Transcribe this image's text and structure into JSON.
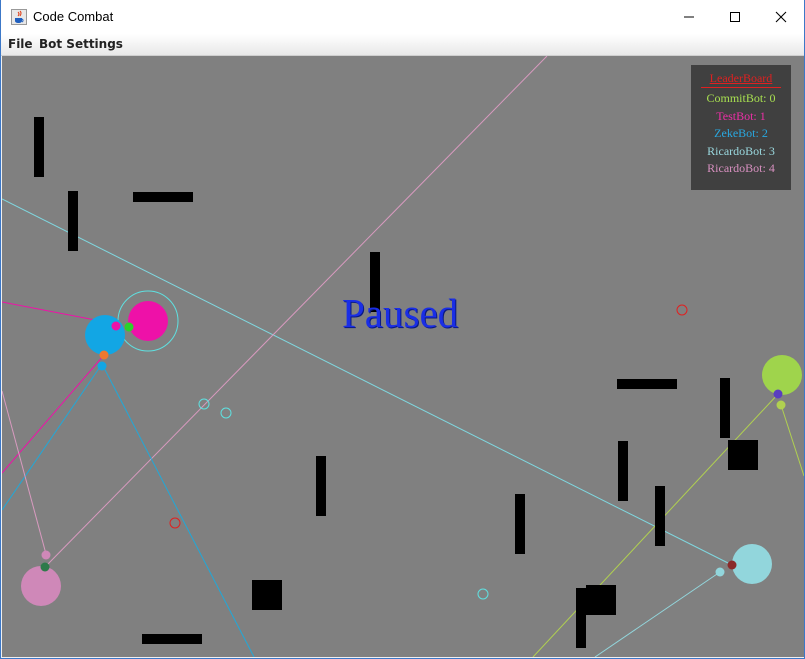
{
  "window": {
    "title": "Code Combat",
    "icon": "java-cup-icon",
    "controls": [
      "minimize-icon",
      "maximize-icon",
      "close-icon"
    ]
  },
  "menu": {
    "items": [
      "File",
      "Bot Settings"
    ]
  },
  "arena": {
    "status_text": "Paused",
    "background_color": "#808080"
  },
  "leaderboard": {
    "title": "LeaderBoard",
    "title_color": "#e02020",
    "rows": [
      {
        "text": "CommitBot: 0",
        "color": "#a8e050"
      },
      {
        "text": "TestBot: 1",
        "color": "#ee2fa8"
      },
      {
        "text": "ZekeBot: 2",
        "color": "#29a8e0"
      },
      {
        "text": "RicardoBot: 3",
        "color": "#9ad8de"
      },
      {
        "text": "RicardoBot: 4",
        "color": "#d890c0"
      }
    ]
  },
  "bots": [
    {
      "name": "CommitBot",
      "color": "#9fd44c"
    },
    {
      "name": "TestBot",
      "color": "#ee11a8"
    },
    {
      "name": "ZekeBot",
      "color": "#12a6e4"
    },
    {
      "name": "RicardoBot",
      "color": "#92d6dc"
    },
    {
      "name": "RicardoBot",
      "color": "#cf88b8"
    }
  ]
}
